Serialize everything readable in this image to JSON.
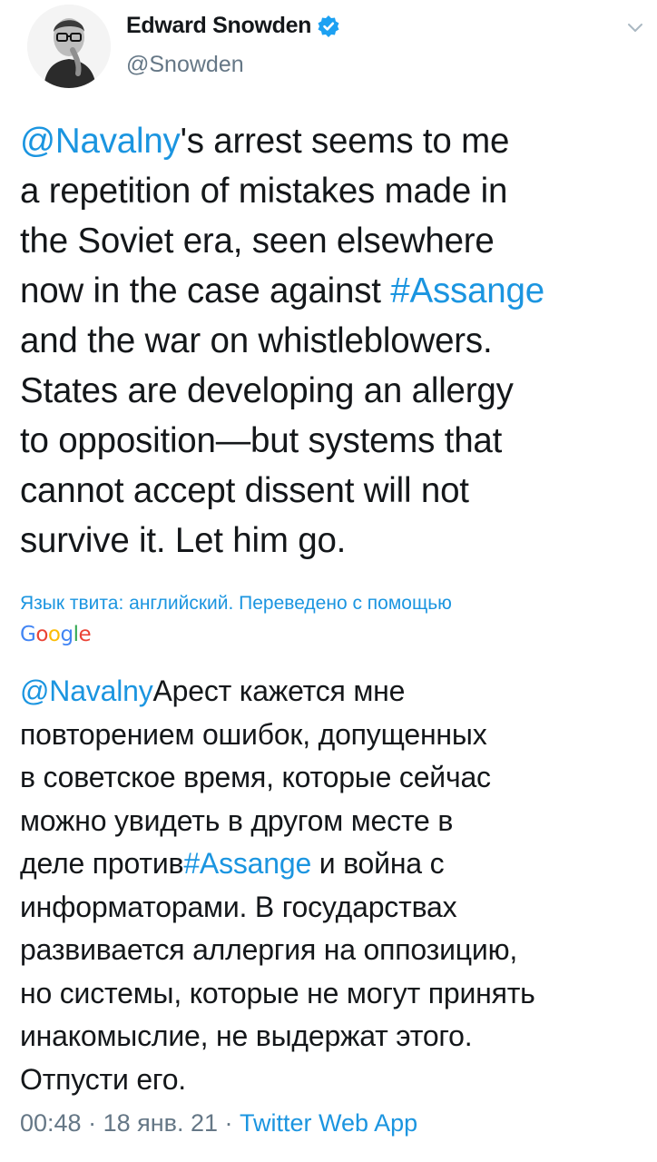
{
  "author": {
    "display_name": "Edward Snowden",
    "handle": "@Snowden",
    "verified": true,
    "verified_icon": "verified-badge-icon",
    "verified_color": "#1da1f2"
  },
  "menu_icon": "chevron-down-icon",
  "tweet": {
    "lines": [
      [
        {
          "text": "@Navalny",
          "link": true
        },
        {
          "text": "'s arrest seems to me",
          "link": false
        }
      ],
      [
        {
          "text": "a repetition of mistakes made in",
          "link": false
        }
      ],
      [
        {
          "text": "the Soviet era, seen elsewhere",
          "link": false
        }
      ],
      [
        {
          "text": "now in the case against ",
          "link": false
        },
        {
          "text": "#Assange",
          "link": true
        }
      ],
      [
        {
          "text": "and the war on whistleblowers.",
          "link": false
        }
      ],
      [
        {
          "text": "States are developing an allergy",
          "link": false
        }
      ],
      [
        {
          "text": "to opposition—but systems that",
          "link": false
        }
      ],
      [
        {
          "text": "cannot accept dissent will not",
          "link": false
        }
      ],
      [
        {
          "text": "survive it. Let him go.",
          "link": false
        }
      ]
    ]
  },
  "translation": {
    "note": "Язык твита: английский. Переведено с помощью",
    "provider": "Google",
    "lines": [
      [
        {
          "text": "@Navalny",
          "link": true
        },
        {
          "text": "Арест кажется мне",
          "link": false
        }
      ],
      [
        {
          "text": "повторением ошибок, допущенных",
          "link": false
        }
      ],
      [
        {
          "text": "в советское время, которые сейчас",
          "link": false
        }
      ],
      [
        {
          "text": "можно увидеть в другом месте в",
          "link": false
        }
      ],
      [
        {
          "text": "деле против",
          "link": false
        },
        {
          "text": "#Assange",
          "link": true
        },
        {
          "text": " и война с",
          "link": false
        }
      ],
      [
        {
          "text": "информаторами. В государствах",
          "link": false
        }
      ],
      [
        {
          "text": "развивается аллергия на оппозицию,",
          "link": false
        }
      ],
      [
        {
          "text": "но системы, которые не могут принять",
          "link": false
        }
      ],
      [
        {
          "text": "инакомыслие, не выдержат этого.",
          "link": false
        }
      ],
      [
        {
          "text": "Отпусти его.",
          "link": false
        }
      ]
    ]
  },
  "meta": {
    "time": "00:48",
    "separator": " · ",
    "date": "18 янв. 21",
    "source": "Twitter Web App"
  },
  "colors": {
    "link": "#1b95e0",
    "secondary_text": "#657786",
    "primary_text": "#14171a"
  }
}
